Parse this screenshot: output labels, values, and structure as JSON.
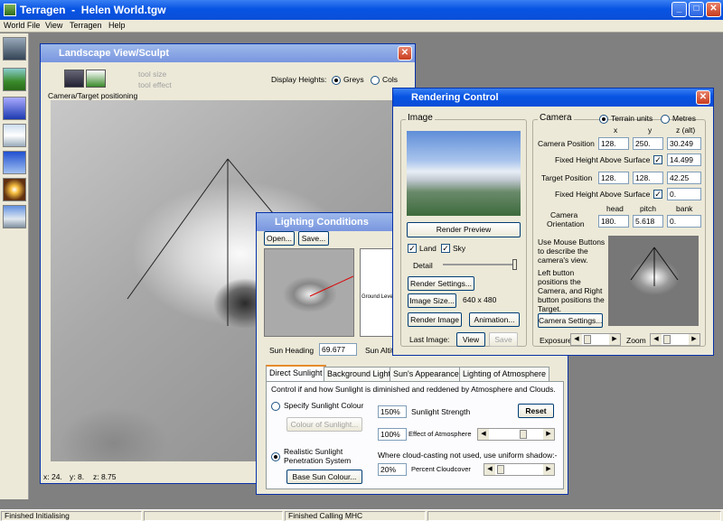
{
  "app": {
    "title": "Terragen  -  Helen World.tgw"
  },
  "menu": [
    "World File",
    "View",
    "Terragen",
    "Help"
  ],
  "toolbar_tools": [
    "camera-tool-icon",
    "landscape-tool-icon",
    "water-tool-icon",
    "clouds-tool-icon",
    "sky-tool-icon",
    "lighting-tool-icon",
    "render-tool-icon"
  ],
  "landscape": {
    "title": "Landscape View/Sculpt",
    "tool_size": "tool size",
    "tool_effect": "tool effect",
    "camera_label": "Camera/Target positioning",
    "display_heights_label": "Display Heights:",
    "opt_greys": "Greys",
    "opt_cols": "Cols",
    "coord_x": "x: 24.",
    "coord_y": "y: 8.",
    "coord_z": "z: 8.75"
  },
  "lighting": {
    "title": "Lighting Conditions",
    "open": "Open...",
    "save": "Save...",
    "ground_level": "Ground Level",
    "sun_heading_label": "Sun Heading",
    "sun_heading_value": "69.677",
    "sun_alt_label": "Sun Altit",
    "tabs": [
      "Direct Sunlight",
      "Background Light",
      "Sun's Appearance",
      "Lighting of Atmosphere"
    ],
    "description": "Control if and how Sunlight is diminished and reddened by Atmosphere and Clouds.",
    "specify_colour": "Specify Sunlight Colour",
    "colour_of_sunlight": "Colour of Sunlight...",
    "strength_value": "150%",
    "strength_label": "Sunlight Strength",
    "reset": "Reset",
    "atmos_value": "100%",
    "atmos_label": "Effect of Atmosphere",
    "realistic_line1": "Realistic Sunlight",
    "realistic_line2": "Penetration System",
    "base_sun_colour": "Base Sun Colour...",
    "cloud_note": "Where cloud-casting not used, use uniform shadow:-",
    "cloudcover_value": "20%",
    "cloudcover_label": "Percent Cloudcover"
  },
  "render": {
    "title": "Rendering Control",
    "image_group": "Image",
    "render_preview": "Render Preview",
    "land": "Land",
    "sky": "Sky",
    "detail": "Detail",
    "render_settings": "Render Settings...",
    "image_size": "Image Size...",
    "size_value": "640 x 480",
    "render_image": "Render Image",
    "animation": "Animation...",
    "last_image": "Last Image:",
    "view": "View",
    "save": "Save",
    "camera_group": "Camera",
    "terrain_units": "Terrain units",
    "metres": "Metres",
    "col_x": "x",
    "col_y": "y",
    "col_z": "z (alt)",
    "camera_position_label": "Camera Position",
    "cam_x": "128.",
    "cam_y": "250.",
    "cam_z": "30.249",
    "fixed_height_label": "Fixed Height Above Surface",
    "cam_fixed_value": "14.499",
    "target_position_label": "Target Position",
    "tgt_x": "128.",
    "tgt_y": "128.",
    "tgt_z": "42.25",
    "tgt_fixed_value": "0.",
    "col_head": "head",
    "col_pitch": "pitch",
    "col_bank": "bank",
    "orientation_line1": "Camera",
    "orientation_line2": "Orientation",
    "head": "180.",
    "pitch": "5.618",
    "bank": "0.",
    "mouse_help1": "Use Mouse Buttons to describe the camera's view.",
    "mouse_help2": "Left button positions the Camera, and Right button positions the Target.",
    "camera_settings": "Camera Settings...",
    "exposure": "Exposure",
    "zoom": "Zoom"
  },
  "status": {
    "left": "Finished Initialising",
    "middle": "Finished Calling MHC"
  },
  "colors": {
    "titlebar": "#0a4ed8",
    "face": "#ece9d8",
    "mdi": "#808080"
  }
}
